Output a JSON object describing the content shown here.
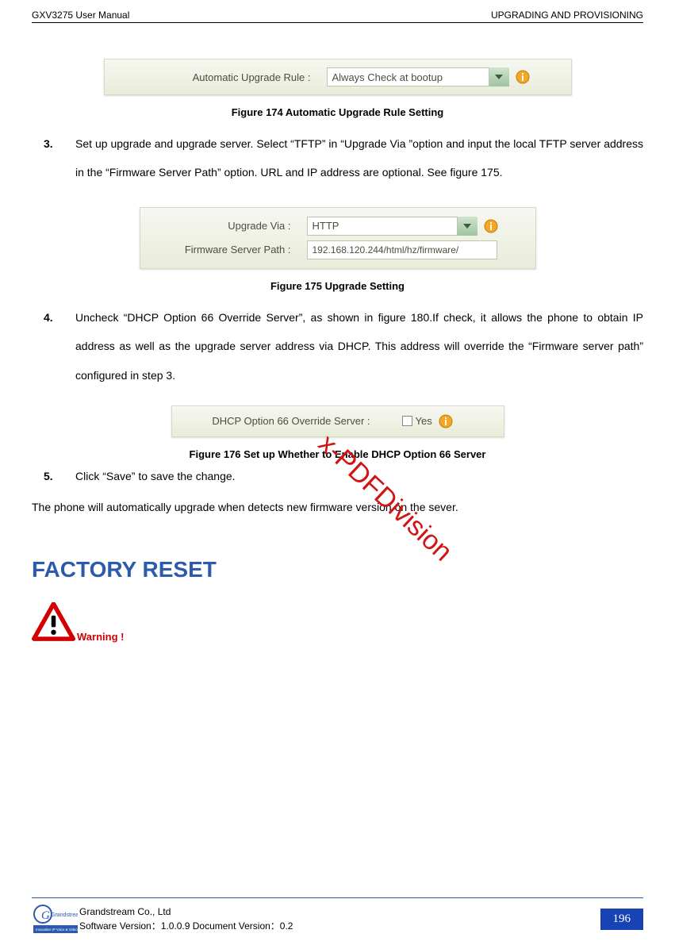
{
  "header": {
    "left": "GXV3275 User Manual",
    "right": "UPGRADING AND PROVISIONING"
  },
  "figure174": {
    "label": "Automatic Upgrade Rule :",
    "value": "Always Check at bootup",
    "caption": "Figure 174 Automatic Upgrade Rule Setting"
  },
  "step3": {
    "num": "3.",
    "text": "Set up upgrade and upgrade server. Select  “TFTP” in “Upgrade Via ”option and input the local TFTP server address in the “Firmware Server Path” option. URL and IP address are optional. See figure 175."
  },
  "figure175": {
    "row1_label": "Upgrade Via :",
    "row1_value": "HTTP",
    "row2_label": "Firmware Server Path :",
    "row2_value": "192.168.120.244/html/hz/firmware/",
    "caption": "Figure 175 Upgrade Setting"
  },
  "step4": {
    "num": "4.",
    "text": "Uncheck “DHCP Option 66 Override Server”, as shown in figure 180.If check, it allows the phone to obtain IP address as well as the upgrade server address via DHCP. This address will override the “Firmware server path” configured in step 3."
  },
  "figure176": {
    "label": "DHCP Option 66 Override Server :",
    "cbtext": "Yes",
    "caption": "Figure 176 Set up Whether to Enable DHCP Option 66 Server"
  },
  "step5": {
    "num": "5.",
    "text": "Click “Save” to save the change."
  },
  "closing": "The phone will automatically upgrade when detects new firmware version on the sever.",
  "factory_heading": "FACTORY RESET",
  "warning_text": "Warning !",
  "watermark": "x-PDFDivision",
  "footer": {
    "company": "Grandstream Co., Ltd",
    "version": "Software Version：1.0.0.9 Document Version：0.2",
    "page": "196",
    "logo_main": "Grandstream",
    "logo_sub": "Innovative IP Voice & Video"
  }
}
